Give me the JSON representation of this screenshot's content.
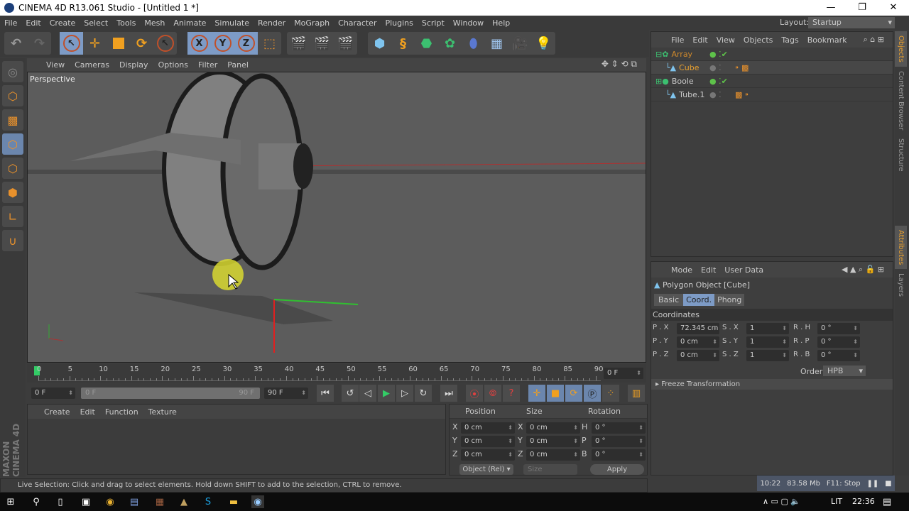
{
  "window": {
    "title": "CINEMA 4D R13.061 Studio - [Untitled 1 *]",
    "min": "—",
    "restore": "❐",
    "close": "✕"
  },
  "menu": [
    "File",
    "Edit",
    "Create",
    "Select",
    "Tools",
    "Mesh",
    "Animate",
    "Simulate",
    "Render",
    "MoGraph",
    "Character",
    "Plugins",
    "Script",
    "Window",
    "Help"
  ],
  "layout": {
    "label": "Layout:",
    "value": "Startup"
  },
  "viewport": {
    "menu": [
      "View",
      "Cameras",
      "Display",
      "Options",
      "Filter",
      "Panel"
    ],
    "label": "Perspective"
  },
  "timeline": {
    "ticks": [
      "0",
      "5",
      "10",
      "15",
      "20",
      "25",
      "30",
      "35",
      "40",
      "45",
      "50",
      "55",
      "60",
      "65",
      "70",
      "75",
      "80",
      "85",
      "90"
    ],
    "current": "0 F",
    "start": "0 F",
    "range_start": "0 F",
    "range_end": "90 F",
    "end": "90 F"
  },
  "material": {
    "menu": [
      "Create",
      "Edit",
      "Function",
      "Texture"
    ]
  },
  "coords": {
    "headers": [
      "Position",
      "Size",
      "Rotation"
    ],
    "rows": [
      {
        "a": "X",
        "p": "0 cm",
        "b": "X",
        "s": "0 cm",
        "c": "H",
        "r": "0 °"
      },
      {
        "a": "Y",
        "p": "0 cm",
        "b": "Y",
        "s": "0 cm",
        "c": "P",
        "r": "0 °"
      },
      {
        "a": "Z",
        "p": "0 cm",
        "b": "Z",
        "s": "0 cm",
        "c": "B",
        "r": "0 °"
      }
    ],
    "mode": "Object (Rel)",
    "size_mode": "Size",
    "apply": "Apply"
  },
  "status": {
    "text": "Live Selection: Click and drag to select elements. Hold down SHIFT to add to the selection, CTRL to remove.",
    "time": "10:22",
    "memory": "83.58 Mb",
    "render": "F11: Stop"
  },
  "objects": {
    "menu": [
      "File",
      "Edit",
      "View",
      "Objects",
      "Tags",
      "Bookmark"
    ],
    "items": [
      {
        "name": "Array",
        "color": "#d08a2c"
      },
      {
        "name": "Cube",
        "color": "#e8a030"
      },
      {
        "name": "Boole",
        "color": "#c8c8c8"
      },
      {
        "name": "Tube.1",
        "color": "#c8c8c8"
      }
    ]
  },
  "attributes": {
    "menu": [
      "Mode",
      "Edit",
      "User Data"
    ],
    "title": "Polygon Object [Cube]",
    "tabs": [
      "Basic",
      "Coord.",
      "Phong"
    ],
    "section": "Coordinates",
    "fields": [
      {
        "l": "P . X",
        "v": "72.345 cm"
      },
      {
        "l": "S . X",
        "v": "1"
      },
      {
        "l": "R . H",
        "v": "0 °"
      },
      {
        "l": "P . Y",
        "v": "0 cm"
      },
      {
        "l": "S . Y",
        "v": "1"
      },
      {
        "l": "R . P",
        "v": "0 °"
      },
      {
        "l": "P . Z",
        "v": "0 cm"
      },
      {
        "l": "S . Z",
        "v": "1"
      },
      {
        "l": "R . B",
        "v": "0 °"
      }
    ],
    "order_label": "Order",
    "order": "HPB",
    "freeze": "Freeze Transformation"
  },
  "side_tabs": [
    "Objects",
    "Content Browser",
    "Structure",
    "Attributes",
    "Layers"
  ],
  "brand": "MAXON CINEMA 4D",
  "taskbar": {
    "lang": "LIT",
    "clock": "22:36"
  }
}
